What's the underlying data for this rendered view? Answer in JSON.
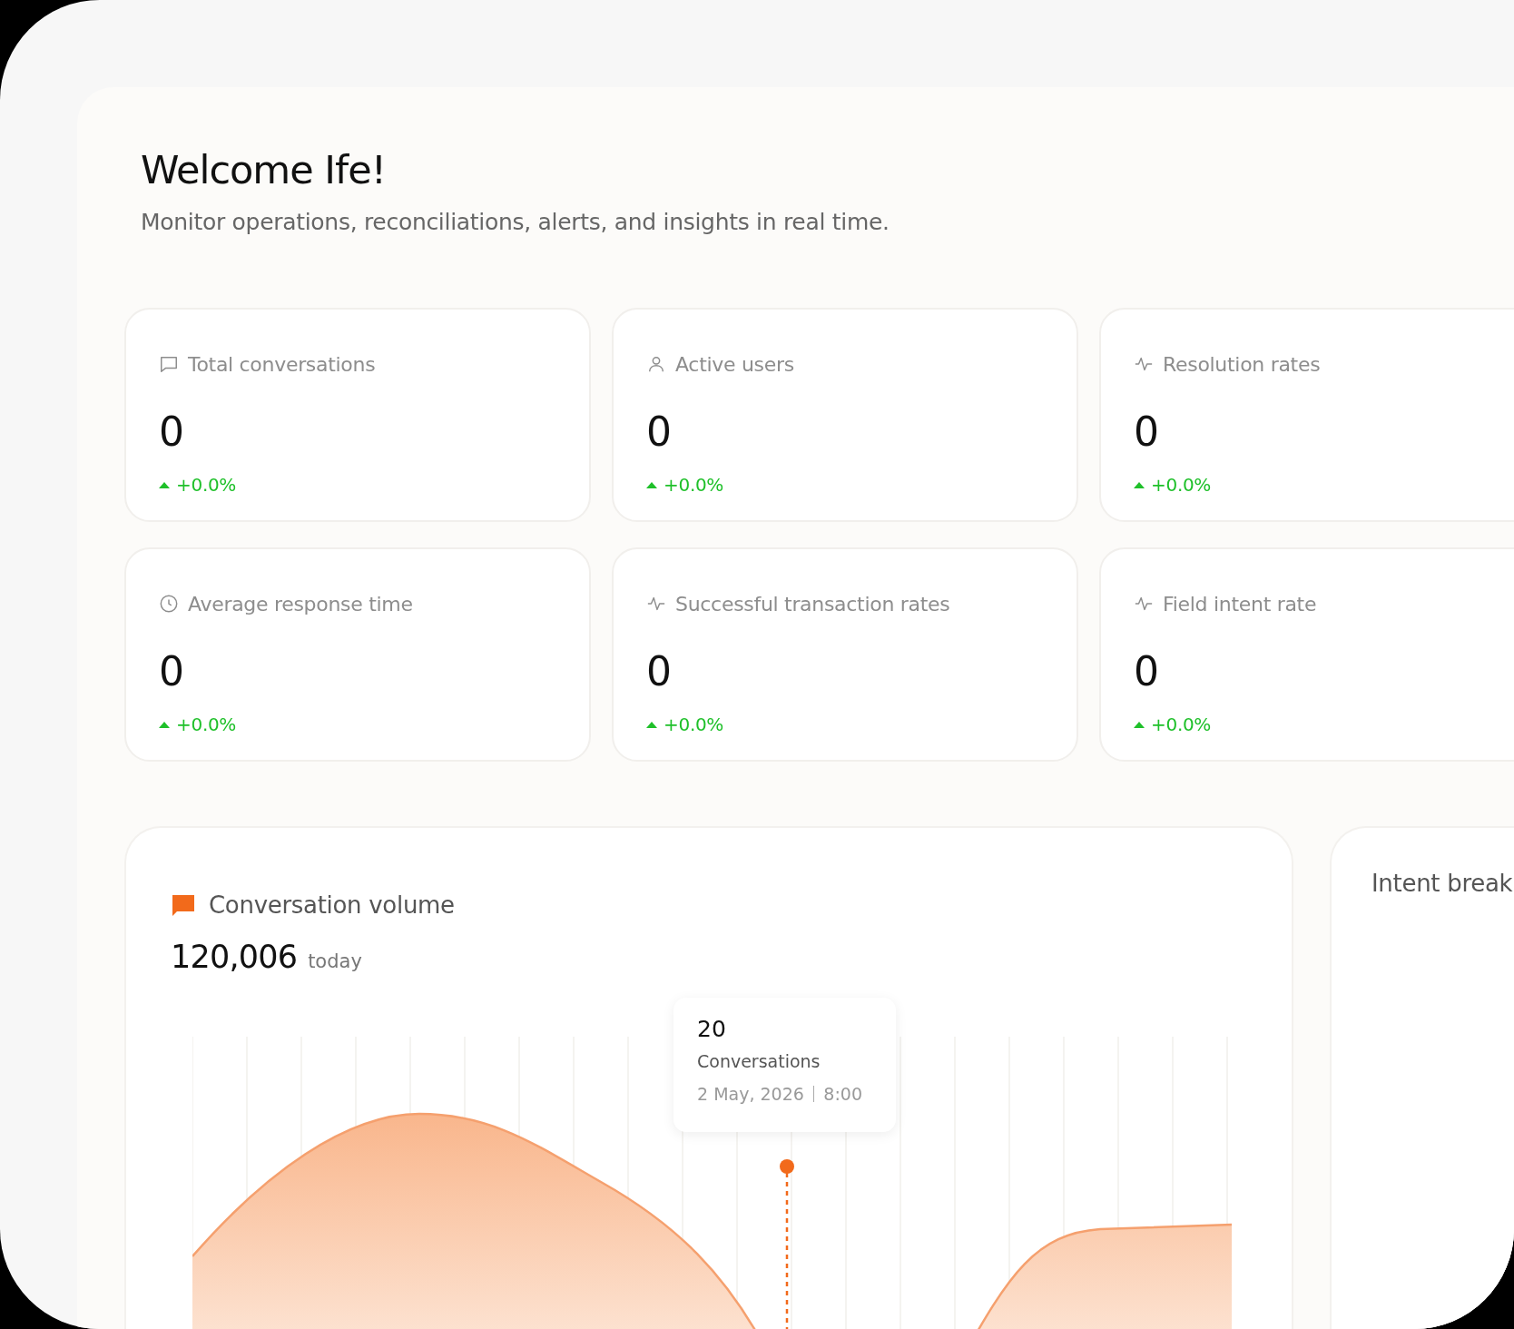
{
  "greeting": {
    "title": "Welcome Ife!",
    "subtitle": "Monitor operations, reconciliations, alerts, and insights in real time."
  },
  "stats": [
    {
      "kind": "chat",
      "label": "Total conversations",
      "value": "0",
      "change": "+0.0%"
    },
    {
      "kind": "user",
      "label": "Active users",
      "value": "0",
      "change": "+0.0%"
    },
    {
      "kind": "pulse",
      "label": "Resolution rates",
      "value": "0",
      "change": "+0.0%"
    },
    {
      "kind": "clock",
      "label": "Average response time",
      "value": "0",
      "change": "+0.0%"
    },
    {
      "kind": "pulse",
      "label": "Successful transaction rates",
      "value": "0",
      "change": "+0.0%"
    },
    {
      "kind": "pulse",
      "label": "Field intent rate",
      "value": "0",
      "change": "+0.0%"
    }
  ],
  "conversation_volume": {
    "title": "Conversation volume",
    "total": "120,006",
    "period": "today",
    "tooltip": {
      "value": "20",
      "label": "Conversations",
      "date": "2 May, 2026",
      "time": "8:00"
    }
  },
  "intent_breakdown": {
    "title": "Intent break"
  }
}
